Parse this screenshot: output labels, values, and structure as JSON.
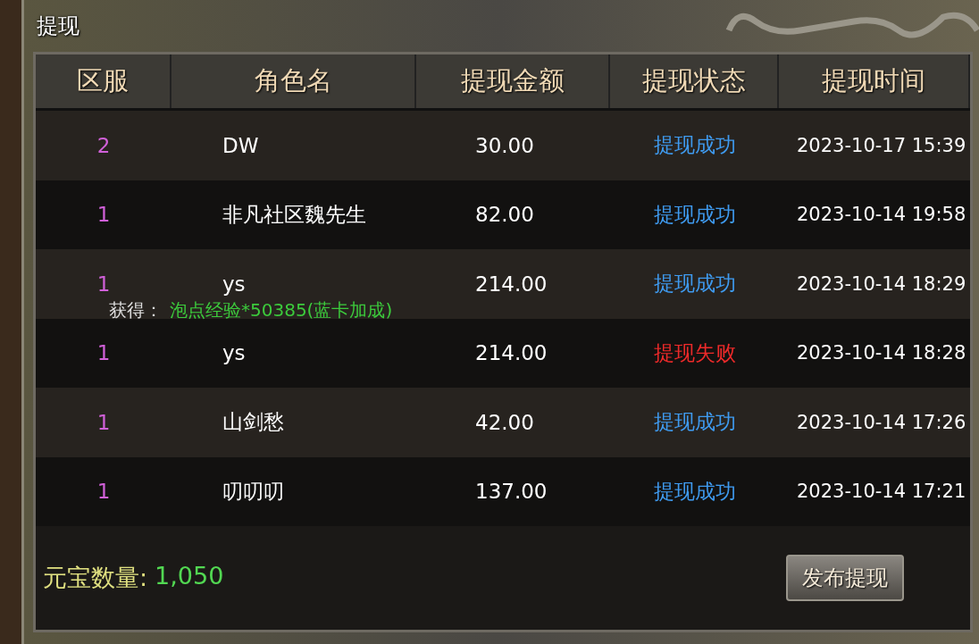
{
  "window": {
    "title": "提现"
  },
  "table": {
    "columns": [
      "区服",
      "角色名",
      "提现金额",
      "提现状态",
      "提现时间"
    ],
    "rows": [
      {
        "zone": "2",
        "name": "DW",
        "amount": "30.00",
        "status": {
          "text": "提现成功",
          "kind": "success"
        },
        "time": "2023-10-17 15:39"
      },
      {
        "zone": "1",
        "name": "非凡社区魏先生",
        "amount": "82.00",
        "status": {
          "text": "提现成功",
          "kind": "success"
        },
        "time": "2023-10-14 19:58"
      },
      {
        "zone": "1",
        "name": "ys",
        "amount": "214.00",
        "status": {
          "text": "提现成功",
          "kind": "success"
        },
        "time": "2023-10-14 18:29"
      },
      {
        "zone": "1",
        "name": "ys",
        "amount": "214.00",
        "status": {
          "text": "提现失败",
          "kind": "failure"
        },
        "time": "2023-10-14 18:28"
      },
      {
        "zone": "1",
        "name": "山剑愁",
        "amount": "42.00",
        "status": {
          "text": "提现成功",
          "kind": "success"
        },
        "time": "2023-10-14 17:26"
      },
      {
        "zone": "1",
        "name": "叨叨叨",
        "amount": "137.00",
        "status": {
          "text": "提现成功",
          "kind": "success"
        },
        "time": "2023-10-14 17:21"
      }
    ]
  },
  "notification": {
    "label": "获得：",
    "value": "泡点经验*50385(蓝卡加成)"
  },
  "footer": {
    "label": "元宝数量:",
    "value": "1,050",
    "button": "发布提现"
  }
}
